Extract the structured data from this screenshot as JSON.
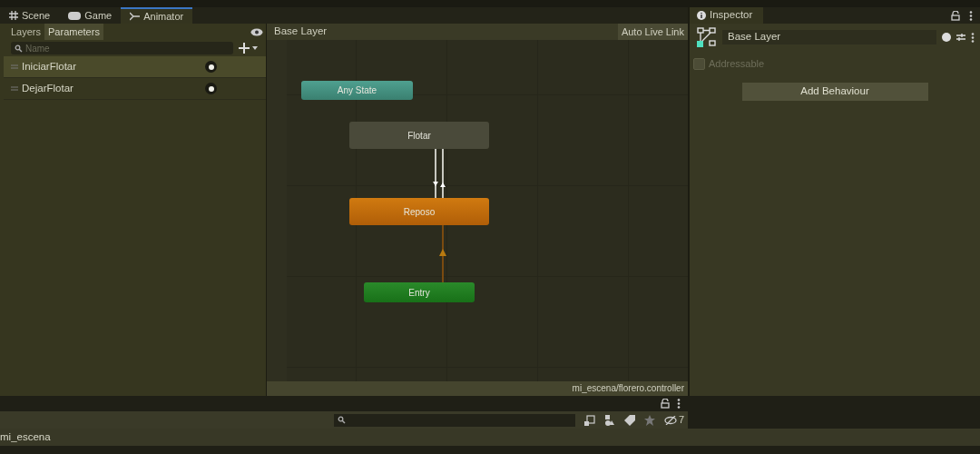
{
  "tabs": [
    {
      "label": "Scene",
      "kind": "scene",
      "selected": false
    },
    {
      "label": "Game",
      "kind": "game",
      "selected": false
    },
    {
      "label": "Animator",
      "kind": "animator",
      "selected": true
    }
  ],
  "animator": {
    "side_tabs": [
      {
        "label": "Layers",
        "selected": false
      },
      {
        "label": "Parameters",
        "selected": true
      }
    ],
    "search": {
      "placeholder": "Name"
    },
    "parameters": [
      {
        "name": "IniciarFlotar",
        "selected": true
      },
      {
        "name": "DejarFlotar",
        "selected": false
      }
    ],
    "breadcrumb": "Base Layer",
    "auto_live_link": "Auto Live Link",
    "states": [
      {
        "label": "Any State",
        "kind": "any"
      },
      {
        "label": "Flotar",
        "kind": "normal"
      },
      {
        "label": "Reposo",
        "kind": "default"
      },
      {
        "label": "Entry",
        "kind": "entry"
      }
    ],
    "controller_path": "mi_escena/florero.controller"
  },
  "inspector": {
    "title": "Inspector",
    "name_field": "Base Layer",
    "addressable": {
      "label": "Addressable",
      "checked": false
    },
    "add_button": "Add Behaviour"
  },
  "project": {
    "hidden_count": "7",
    "scene_item": "mi_escena"
  }
}
